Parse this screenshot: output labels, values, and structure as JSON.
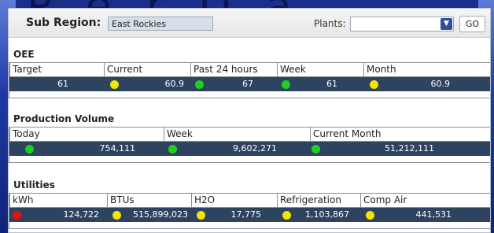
{
  "sub_region": {
    "label": "Sub Region:",
    "value": "East Rockies"
  },
  "plants": {
    "label": "Plants:",
    "selected": ""
  },
  "go_label": "GO",
  "colors": {
    "green": "#1ecf1e",
    "yellow": "#f3e500",
    "red": "#e11212",
    "row_bg": "#2e4360"
  },
  "oee": {
    "title": "OEE",
    "headers": [
      "Target",
      "Current",
      "Past 24 hours",
      "Week",
      "Month"
    ],
    "values": [
      {
        "status": "none",
        "value": "61"
      },
      {
        "status": "yellow",
        "value": "60.9"
      },
      {
        "status": "green",
        "value": "67"
      },
      {
        "status": "green",
        "value": "61"
      },
      {
        "status": "yellow",
        "value": "60.9"
      }
    ]
  },
  "production": {
    "title": "Production Volume",
    "headers": [
      "Today",
      "Week",
      "Current Month"
    ],
    "values": [
      {
        "status": "green",
        "value": "754,111"
      },
      {
        "status": "green",
        "value": "9,602,271"
      },
      {
        "status": "green",
        "value": "51,212,111"
      }
    ]
  },
  "utilities": {
    "title": "Utilities",
    "headers": [
      "kWh",
      "BTUs",
      "H2O",
      "Refrigeration",
      "Comp Air"
    ],
    "values": [
      {
        "status": "red",
        "value": "124,722"
      },
      {
        "status": "yellow",
        "value": "515,899,023"
      },
      {
        "status": "yellow",
        "value": "17,775"
      },
      {
        "status": "yellow",
        "value": "1,103,867"
      },
      {
        "status": "yellow",
        "value": "441,531"
      }
    ]
  }
}
